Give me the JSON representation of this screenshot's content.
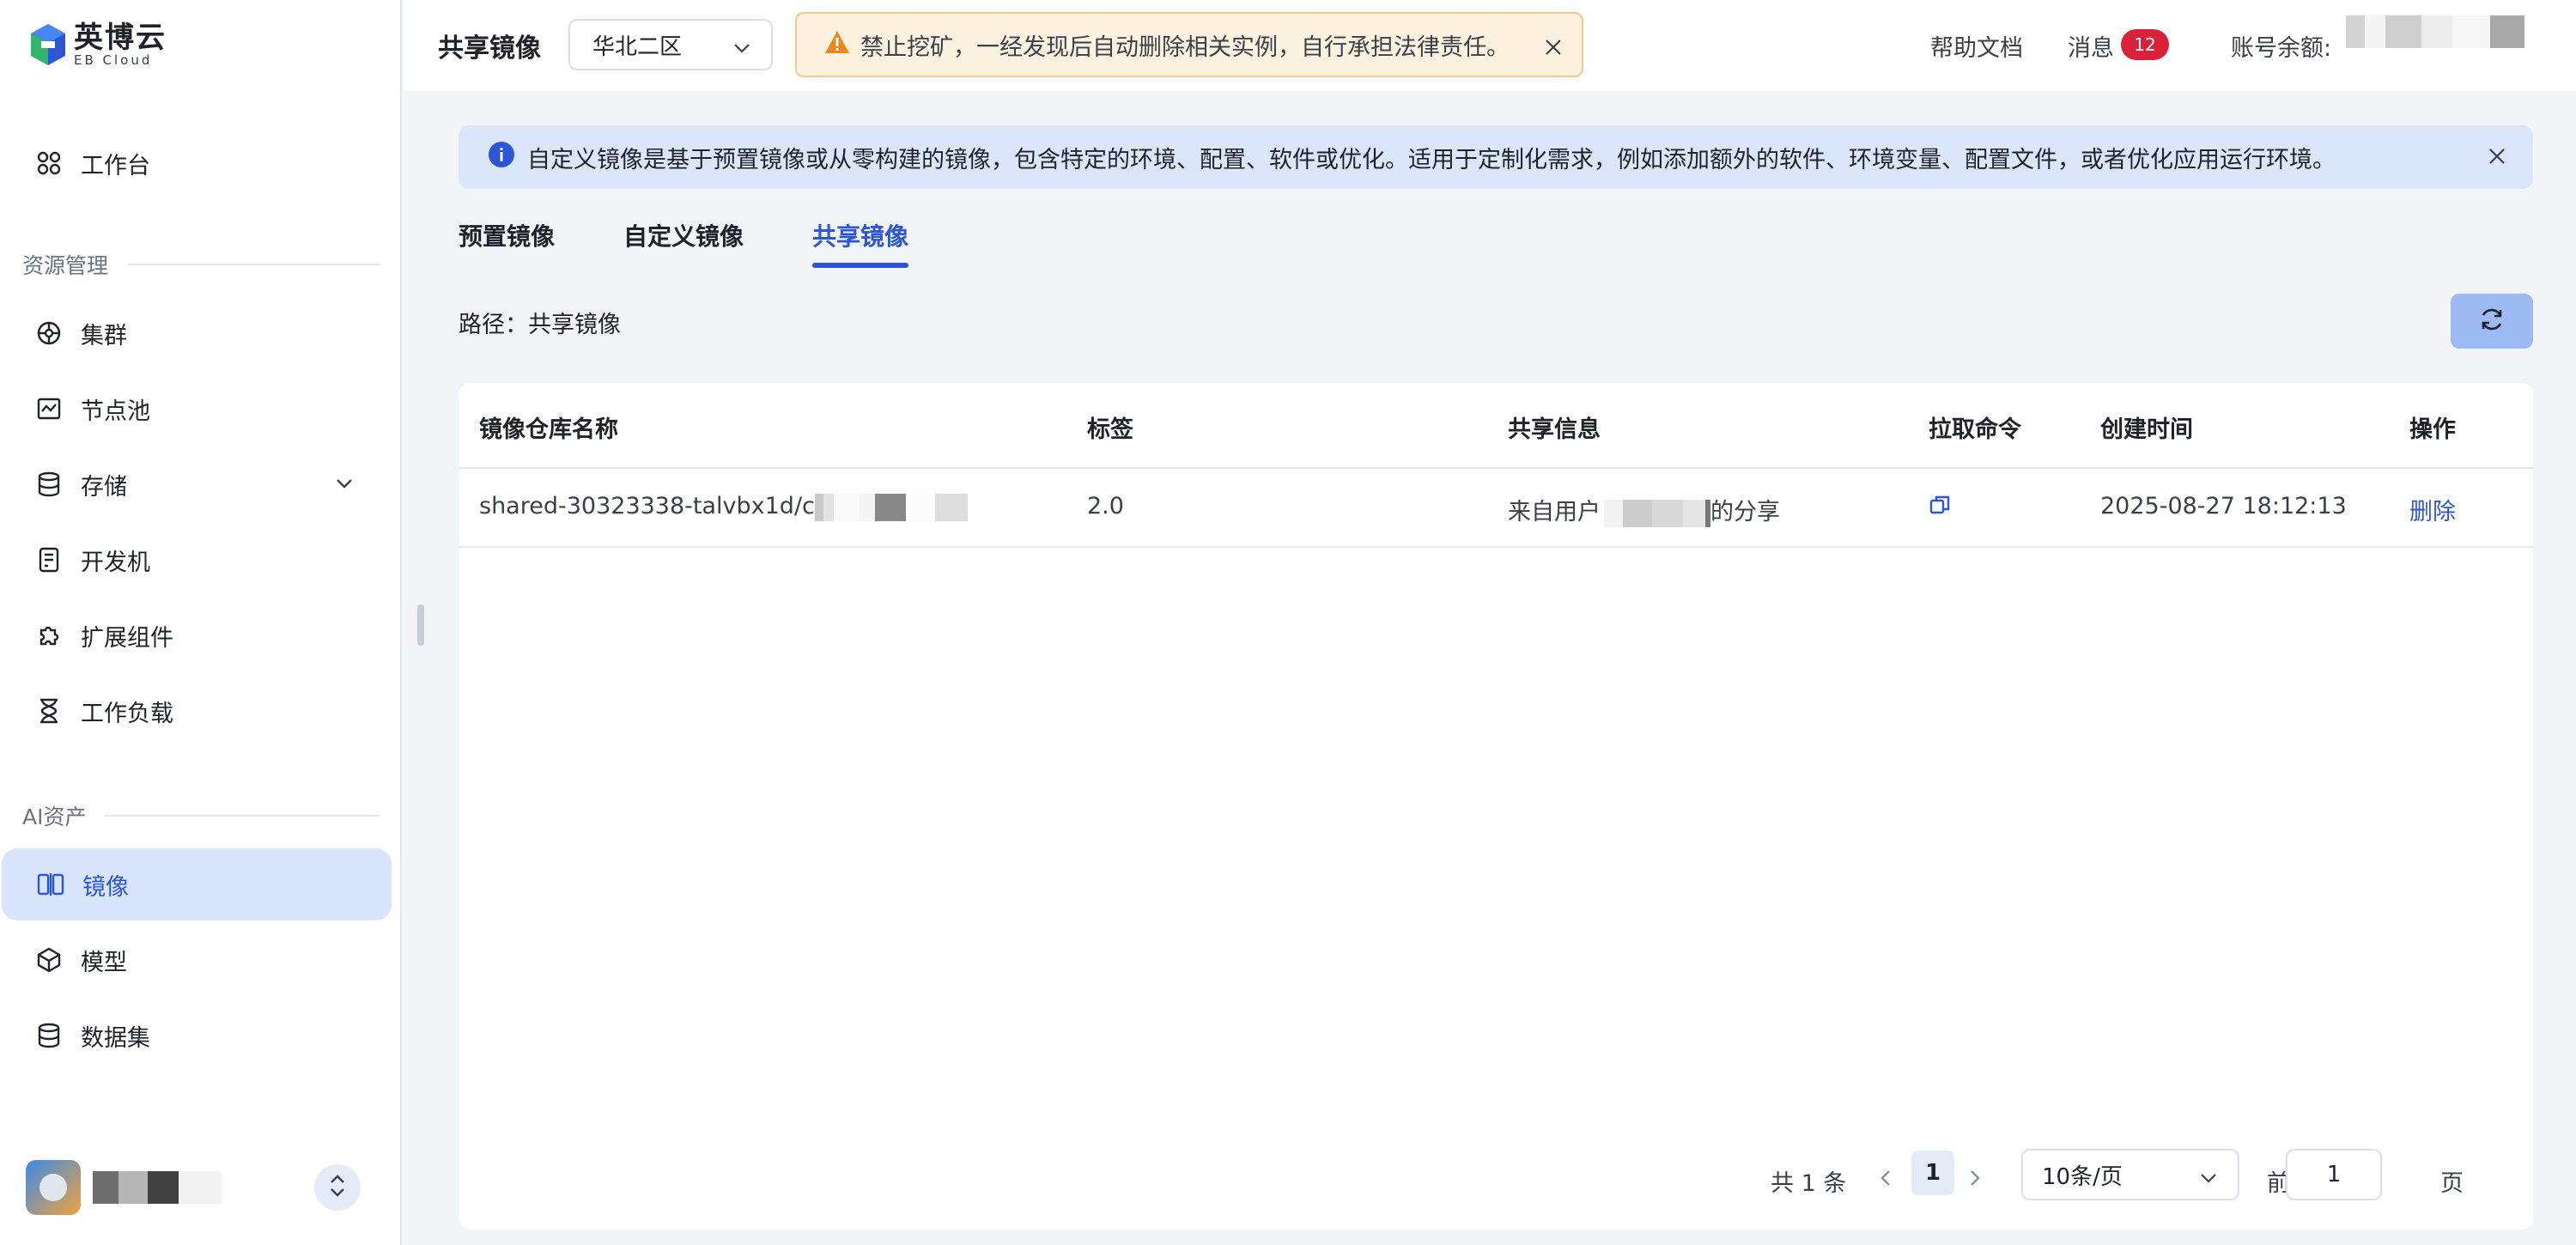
{
  "brand": {
    "name_cn": "英博云",
    "name_en": "EB Cloud"
  },
  "sidebar": {
    "workbench": "工作台",
    "section_resources": "资源管理",
    "resources": [
      {
        "label": "集群",
        "icon": "cluster-icon"
      },
      {
        "label": "节点池",
        "icon": "node-pool-icon"
      },
      {
        "label": "存储",
        "icon": "storage-icon"
      },
      {
        "label": "开发机",
        "icon": "dev-machine-icon"
      },
      {
        "label": "扩展组件",
        "icon": "extension-icon"
      },
      {
        "label": "工作负载",
        "icon": "workload-icon"
      }
    ],
    "section_ai": "AI资产",
    "ai_assets": [
      {
        "label": "镜像",
        "icon": "image-icon",
        "active": true
      },
      {
        "label": "模型",
        "icon": "model-icon"
      },
      {
        "label": "数据集",
        "icon": "dataset-icon"
      }
    ]
  },
  "header": {
    "title": "共享镜像",
    "region": "华北二区",
    "warning": "禁止挖矿，一经发现后自动删除相关实例，自行承担法律责任。",
    "help": "帮助文档",
    "messages": "消息",
    "messages_count": "12",
    "balance_label": "账号余额:"
  },
  "info_banner": "自定义镜像是基于预置镜像或从零构建的镜像，包含特定的环境、配置、软件或优化。适用于定制化需求，例如添加额外的软件、环境变量、配置文件，或者优化应用运行环境。",
  "tabs": [
    "预置镜像",
    "自定义镜像",
    "共享镜像"
  ],
  "active_tab": "共享镜像",
  "path": "路径：共享镜像",
  "table": {
    "columns": [
      "镜像仓库名称",
      "标签",
      "共享信息",
      "拉取命令",
      "创建时间",
      "操作"
    ],
    "rows": [
      {
        "repo": "shared-30323338-talvbx1d/c",
        "tag": "2.0",
        "share_prefix": "来自用户",
        "share_suffix": "的分享",
        "created": "2025-08-27 18:12:13",
        "action": "删除"
      }
    ]
  },
  "pagination": {
    "total": "共 1 条",
    "current": "1",
    "page_size": "10条/页",
    "goto_label": "前往",
    "goto_value": "1",
    "page_suffix": "页"
  },
  "colors": {
    "accent": "#2d56d6",
    "active_bg": "#d9e5fb",
    "warning_bg": "#fdf2df",
    "badge": "#d9213a"
  }
}
